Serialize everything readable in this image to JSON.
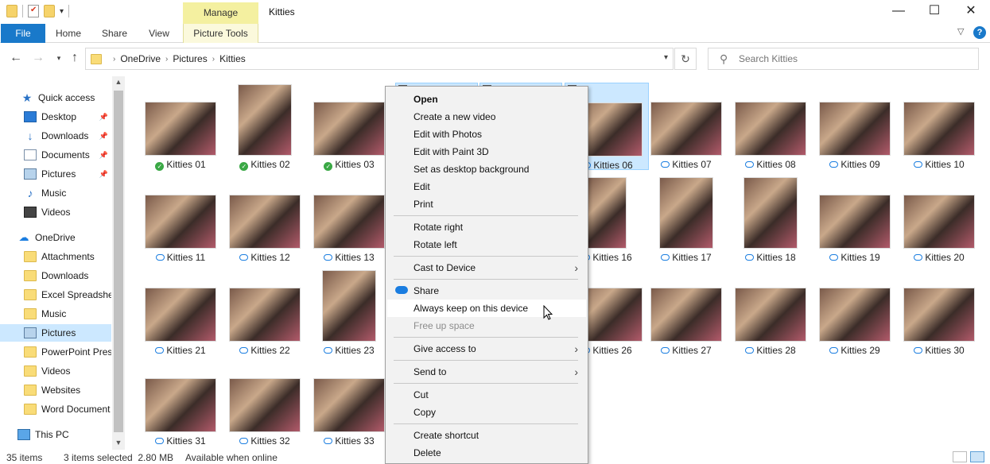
{
  "window": {
    "title": "Kitties",
    "context_tab": "Manage",
    "minimize_glyph": "—",
    "maximize_glyph": "☐",
    "close_glyph": "✕"
  },
  "ribbon": {
    "tabs": [
      "File",
      "Home",
      "Share",
      "View",
      "Picture Tools"
    ],
    "help_glyph": "?"
  },
  "nav": {
    "breadcrumbs": [
      "OneDrive",
      "Pictures",
      "Kitties"
    ],
    "search_placeholder": "Search Kitties"
  },
  "sidebar": {
    "items": [
      {
        "label": "Quick access",
        "icon": "star-icon"
      },
      {
        "label": "Desktop",
        "icon": "desktop-icon"
      },
      {
        "label": "Downloads",
        "icon": "download-icon"
      },
      {
        "label": "Documents",
        "icon": "documents-icon"
      },
      {
        "label": "Pictures",
        "icon": "pictures-icon"
      },
      {
        "label": "Music",
        "icon": "music-icon"
      },
      {
        "label": "Videos",
        "icon": "videos-icon"
      },
      {
        "label": "OneDrive",
        "icon": "onedrive-cloud-icon"
      },
      {
        "label": "Attachments",
        "icon": "folder-icon"
      },
      {
        "label": "Downloads",
        "icon": "folder-icon"
      },
      {
        "label": "Excel Spreadshe",
        "icon": "folder-icon"
      },
      {
        "label": "Music",
        "icon": "folder-icon"
      },
      {
        "label": "Pictures",
        "icon": "pictures-icon"
      },
      {
        "label": "PowerPoint Pres",
        "icon": "folder-icon"
      },
      {
        "label": "Videos",
        "icon": "folder-icon"
      },
      {
        "label": "Websites",
        "icon": "folder-icon"
      },
      {
        "label": "Word Document",
        "icon": "folder-icon"
      },
      {
        "label": "This PC",
        "icon": "computer-icon"
      }
    ]
  },
  "files": [
    {
      "name": "Kitties 01",
      "status": "synced"
    },
    {
      "name": "Kitties 02",
      "status": "synced"
    },
    {
      "name": "Kitties 03",
      "status": "synced"
    },
    {
      "name": "Kitties 06",
      "status": "cloud"
    },
    {
      "name": "Kitties 07",
      "status": "cloud"
    },
    {
      "name": "Kitties 08",
      "status": "cloud"
    },
    {
      "name": "Kitties 09",
      "status": "cloud"
    },
    {
      "name": "Kitties 10",
      "status": "cloud"
    },
    {
      "name": "Kitties 11",
      "status": "cloud"
    },
    {
      "name": "Kitties 12",
      "status": "cloud"
    },
    {
      "name": "Kitties 13",
      "status": "cloud"
    },
    {
      "name": "Kitties 16",
      "status": "cloud"
    },
    {
      "name": "Kitties 17",
      "status": "cloud"
    },
    {
      "name": "Kitties 18",
      "status": "cloud"
    },
    {
      "name": "Kitties 19",
      "status": "cloud"
    },
    {
      "name": "Kitties 20",
      "status": "cloud"
    },
    {
      "name": "Kitties 21",
      "status": "cloud"
    },
    {
      "name": "Kitties 22",
      "status": "cloud"
    },
    {
      "name": "Kitties 23",
      "status": "cloud"
    },
    {
      "name": "Kitties 26",
      "status": "cloud"
    },
    {
      "name": "Kitties 27",
      "status": "cloud"
    },
    {
      "name": "Kitties 28",
      "status": "cloud"
    },
    {
      "name": "Kitties 29",
      "status": "cloud"
    },
    {
      "name": "Kitties 30",
      "status": "cloud"
    },
    {
      "name": "Kitties 31",
      "status": "cloud"
    },
    {
      "name": "Kitties 32",
      "status": "cloud"
    },
    {
      "name": "Kitties 33",
      "status": "cloud"
    }
  ],
  "context_menu": {
    "items": [
      {
        "label": "Open",
        "bold": true
      },
      {
        "label": "Create a new video"
      },
      {
        "label": "Edit with Photos"
      },
      {
        "label": "Edit with Paint 3D"
      },
      {
        "label": "Set as desktop background"
      },
      {
        "label": "Edit"
      },
      {
        "label": "Print"
      },
      {
        "label": "Rotate right"
      },
      {
        "label": "Rotate left"
      },
      {
        "label": "Cast to Device",
        "submenu": true
      },
      {
        "label": "Share",
        "icon": "onedrive-cloud-icon"
      },
      {
        "label": "Always keep on this device",
        "hover": true
      },
      {
        "label": "Free up space",
        "disabled": true
      },
      {
        "label": "Give access to",
        "submenu": true
      },
      {
        "label": "Send to",
        "submenu": true
      },
      {
        "label": "Cut"
      },
      {
        "label": "Copy"
      },
      {
        "label": "Create shortcut"
      },
      {
        "label": "Delete"
      }
    ],
    "submenu_glyph": "›"
  },
  "statusbar": {
    "item_count": "35 items",
    "selection": "3 items selected  2.80 MB",
    "availability": "Available when online"
  },
  "colors": {
    "accent": "#1979ca",
    "selection": "#cce8ff",
    "manage_tab": "#f4f0a0"
  }
}
